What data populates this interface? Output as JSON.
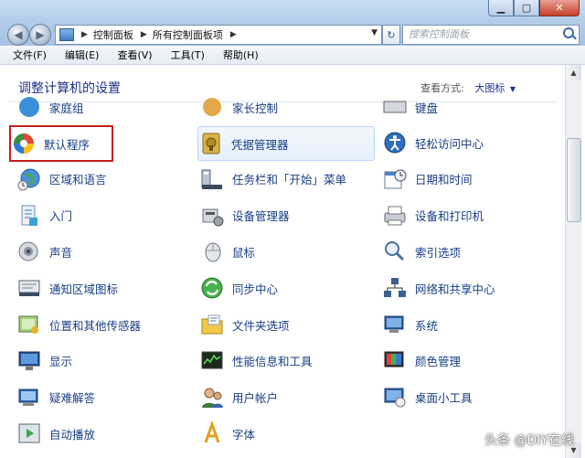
{
  "address": {
    "crumbs": [
      "控制面板",
      "所有控制面板项"
    ],
    "search_placeholder": "搜索控制面板"
  },
  "menu": [
    "文件(F)",
    "编辑(E)",
    "查看(V)",
    "工具(T)",
    "帮助(H)"
  ],
  "heading": "调整计算机的设置",
  "view_by": {
    "label": "查看方式:",
    "value": "大图标"
  },
  "partial_row": [
    "家庭组",
    "家长控制",
    "键盘"
  ],
  "items": [
    [
      "默认程序",
      "凭据管理器",
      "轻松访问中心"
    ],
    [
      "区域和语言",
      "任务栏和「开始」菜单",
      "日期和时间"
    ],
    [
      "入门",
      "设备管理器",
      "设备和打印机"
    ],
    [
      "声音",
      "鼠标",
      "索引选项"
    ],
    [
      "通知区域图标",
      "同步中心",
      "网络和共享中心"
    ],
    [
      "位置和其他传感器",
      "文件夹选项",
      "系统"
    ],
    [
      "显示",
      "性能信息和工具",
      "颜色管理"
    ],
    [
      "疑难解答",
      "用户帐户",
      "桌面小工具"
    ],
    [
      "自动播放",
      "字体",
      ""
    ]
  ],
  "icons": [
    [
      "default-programs-icon",
      "credential-manager-icon",
      "ease-of-access-icon"
    ],
    [
      "region-language-icon",
      "taskbar-icon",
      "date-time-icon"
    ],
    [
      "getting-started-icon",
      "device-manager-icon",
      "devices-printers-icon"
    ],
    [
      "sound-icon",
      "mouse-icon",
      "indexing-options-icon"
    ],
    [
      "notification-area-icon",
      "sync-center-icon",
      "network-sharing-icon"
    ],
    [
      "location-sensors-icon",
      "folder-options-icon",
      "system-icon"
    ],
    [
      "display-icon",
      "performance-icon",
      "color-management-icon"
    ],
    [
      "troubleshooting-icon",
      "user-accounts-icon",
      "desktop-gadgets-icon"
    ],
    [
      "autoplay-icon",
      "fonts-icon",
      ""
    ]
  ],
  "highlighted_item": "默认程序",
  "hovered_item": "凭据管理器",
  "watermark": "头条 @DIY在线",
  "colors": {
    "link": "#1a3e84",
    "heading": "#1e3287",
    "highlight_border": "#c81e1e"
  }
}
